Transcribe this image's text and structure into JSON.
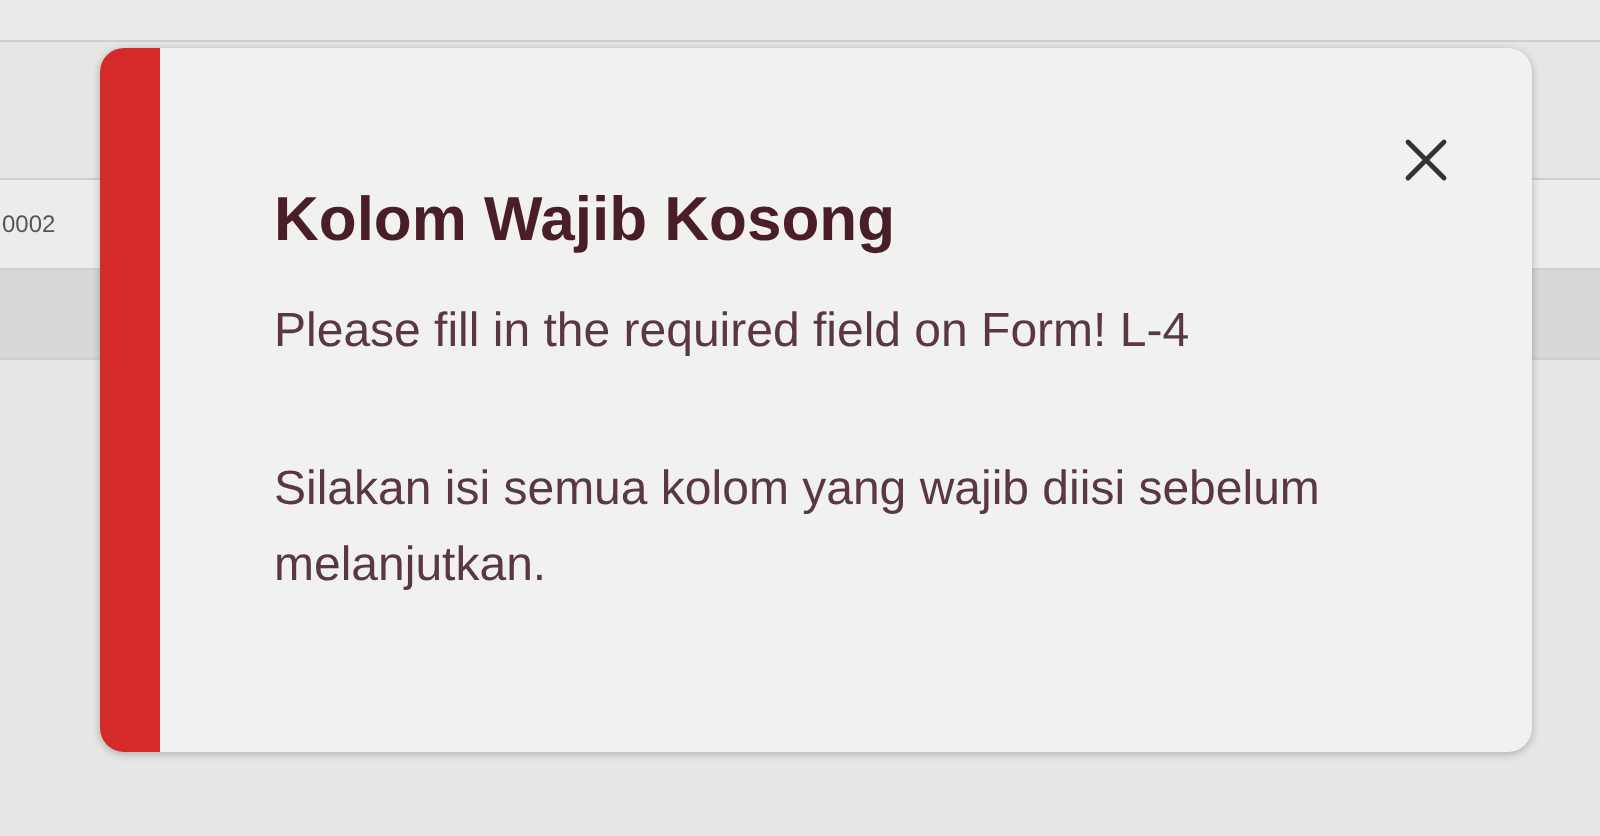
{
  "table": {
    "rows": [
      {
        "cell": "0002"
      }
    ]
  },
  "toast": {
    "title": "Kolom Wajib Kosong",
    "message": "Please fill in the required field on Form! L-4",
    "detail": "Silakan isi semua kolom yang wajib diisi sebelum melanjutkan."
  }
}
